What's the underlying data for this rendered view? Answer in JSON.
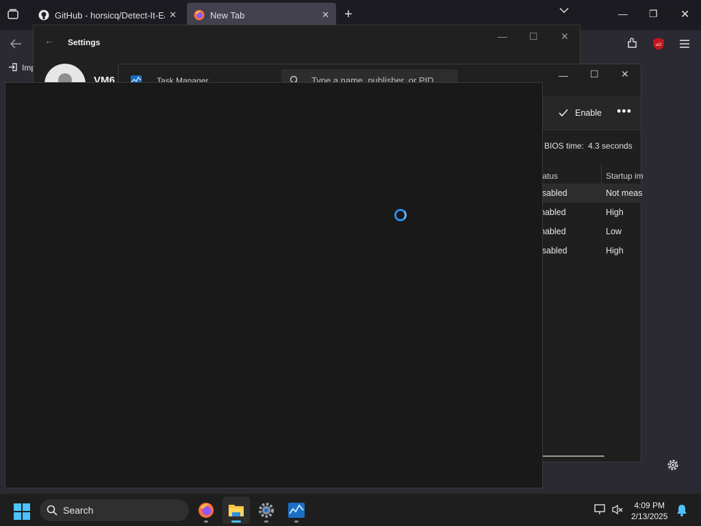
{
  "browser": {
    "tabs": [
      {
        "label": "GitHub - horsicq/Detect-It-Easy",
        "icon": "github-icon",
        "active": false
      },
      {
        "label": "New Tab",
        "icon": "firefox-icon",
        "active": true
      }
    ],
    "new_tab_label": "+",
    "tab_list_label": "⌄",
    "bookmark_label": "Imp"
  },
  "settings": {
    "title": "Settings",
    "user_name": "VM6"
  },
  "task_manager": {
    "title": "Task Manager",
    "search_placeholder": "Type a name, publisher, or PID...",
    "enable_label": "Enable",
    "more_label": "•••",
    "bios_label": "BIOS time:",
    "bios_value": "4.3 seconds",
    "columns": [
      "tatus",
      "Startup im"
    ],
    "rows": [
      {
        "status": "isabled",
        "impact": "Not meas",
        "selected": true
      },
      {
        "status": "nabled",
        "impact": "High",
        "selected": false
      },
      {
        "status": "nabled",
        "impact": "Low",
        "selected": false
      },
      {
        "status": "isabled",
        "impact": "High",
        "selected": false
      }
    ]
  },
  "taskbar": {
    "search_label": "Search",
    "time": "4:09 PM",
    "date": "2/13/2025"
  },
  "colors": {
    "accent": "#4cc2ff",
    "spinner": "#2b8fe8",
    "ublock_red": "#c0161b"
  }
}
